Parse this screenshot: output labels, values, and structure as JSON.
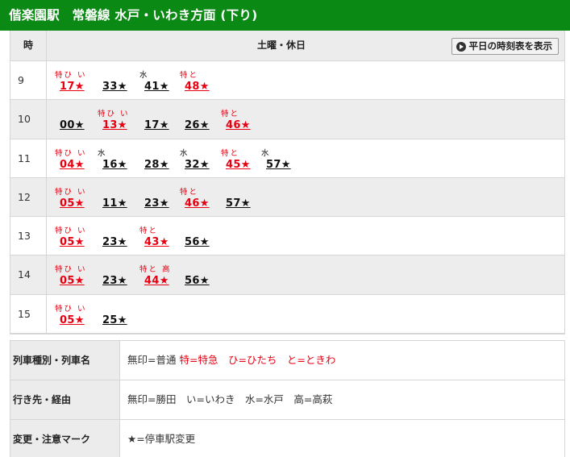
{
  "header": {
    "title": "偕楽園駅　常磐線 水戸・いわき方面 (下り)"
  },
  "table": {
    "hour_header": "時",
    "day_header": "土曜・休日",
    "switch_button": "平日の時刻表を表示",
    "accent_color": "#0a8a14",
    "red_color": "#e60012",
    "rows": [
      {
        "hour": "9",
        "deps": [
          {
            "mark": "特ひ い",
            "time": "17★",
            "color": "red"
          },
          {
            "mark": "",
            "time": "33★",
            "color": "black"
          },
          {
            "mark": "水",
            "time": "41★",
            "color": "black"
          },
          {
            "mark": "特と",
            "time": "48★",
            "color": "red"
          }
        ]
      },
      {
        "hour": "10",
        "deps": [
          {
            "mark": "",
            "time": "00★",
            "color": "black"
          },
          {
            "mark": "特ひ い",
            "time": "13★",
            "color": "red"
          },
          {
            "mark": "",
            "time": "17★",
            "color": "black"
          },
          {
            "mark": "",
            "time": "26★",
            "color": "black"
          },
          {
            "mark": "特と",
            "time": "46★",
            "color": "red"
          }
        ]
      },
      {
        "hour": "11",
        "deps": [
          {
            "mark": "特ひ い",
            "time": "04★",
            "color": "red"
          },
          {
            "mark": "水",
            "time": "16★",
            "color": "black"
          },
          {
            "mark": "",
            "time": "28★",
            "color": "black"
          },
          {
            "mark": "水",
            "time": "32★",
            "color": "black"
          },
          {
            "mark": "特と",
            "time": "45★",
            "color": "red"
          },
          {
            "mark": "水",
            "time": "57★",
            "color": "black"
          }
        ]
      },
      {
        "hour": "12",
        "deps": [
          {
            "mark": "特ひ い",
            "time": "05★",
            "color": "red"
          },
          {
            "mark": "",
            "time": "11★",
            "color": "black"
          },
          {
            "mark": "",
            "time": "23★",
            "color": "black"
          },
          {
            "mark": "特と",
            "time": "46★",
            "color": "red"
          },
          {
            "mark": "",
            "time": "57★",
            "color": "black"
          }
        ]
      },
      {
        "hour": "13",
        "deps": [
          {
            "mark": "特ひ い",
            "time": "05★",
            "color": "red"
          },
          {
            "mark": "",
            "time": "23★",
            "color": "black"
          },
          {
            "mark": "特と",
            "time": "43★",
            "color": "red"
          },
          {
            "mark": "",
            "time": "56★",
            "color": "black"
          }
        ]
      },
      {
        "hour": "14",
        "deps": [
          {
            "mark": "特ひ い",
            "time": "05★",
            "color": "red"
          },
          {
            "mark": "",
            "time": "23★",
            "color": "black"
          },
          {
            "mark": "特と 高",
            "time": "44★",
            "color": "red"
          },
          {
            "mark": "",
            "time": "56★",
            "color": "black"
          }
        ]
      },
      {
        "hour": "15",
        "deps": [
          {
            "mark": "特ひ い",
            "time": "05★",
            "color": "red"
          },
          {
            "mark": "",
            "time": "25★",
            "color": "black"
          }
        ]
      }
    ]
  },
  "legend": {
    "type_label": "列車種別・列車名",
    "type_plain": "無印=普通",
    "type_red": "特=特急　ひ=ひたち　と=ときわ",
    "dest_label": "行き先・経由",
    "dest_value": "無印=勝田　い=いわき　水=水戸　高=高萩",
    "mark_label": "変更・注意マーク",
    "mark_value": "★=停車駅変更"
  }
}
